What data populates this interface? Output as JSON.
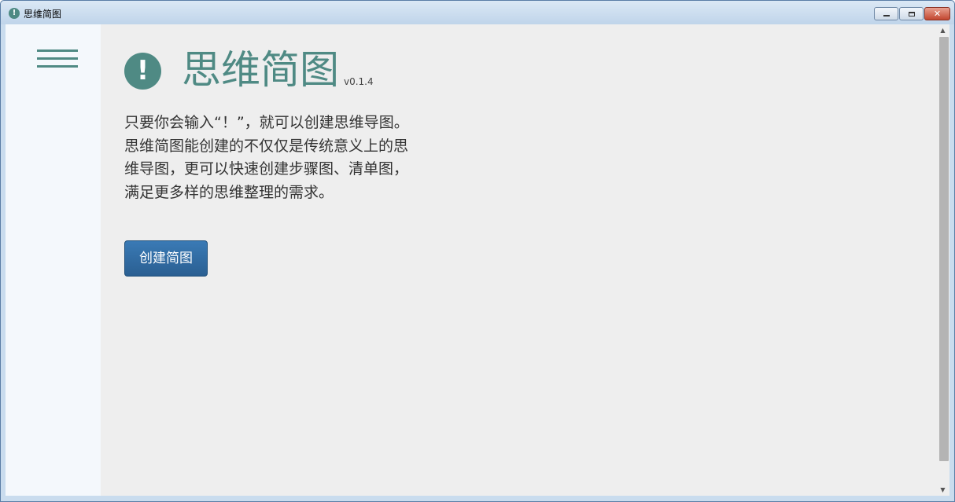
{
  "window": {
    "title": "思维简图",
    "app_icon_glyph": "!",
    "buttons": {
      "close_glyph": "✕"
    }
  },
  "sidebar": {
    "menu_icon": "hamburger-menu-icon"
  },
  "main": {
    "logo_glyph": "!",
    "app_name": "思维简图",
    "version": "v0.1.4",
    "description_lines": [
      "只要你会输入“！”，就可以创建思维导图。",
      "思维简图能创建的不仅仅是传统意义上的思",
      "维导图，更可以快速创建步骤图、清单图，",
      "满足更多样的思维整理的需求。"
    ],
    "create_button_label": "创建简图"
  },
  "colors": {
    "accent": "#4f8a84",
    "button": "#2f6ba3",
    "sidebar_bg": "#f4f8fc",
    "content_bg": "#eeeeee"
  }
}
